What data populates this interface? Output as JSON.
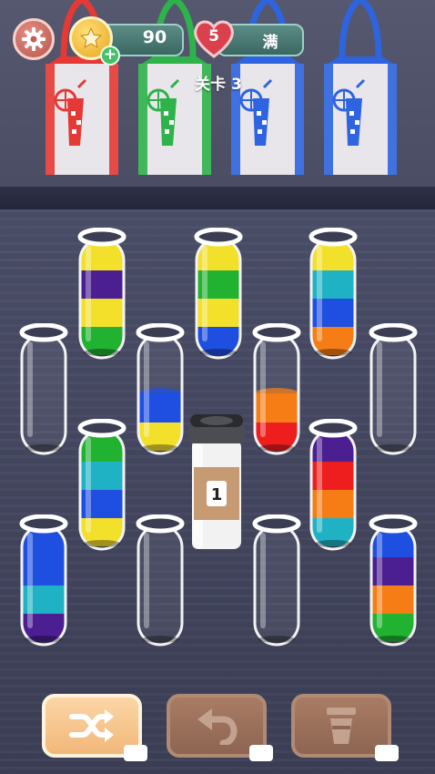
{
  "header": {
    "coins": "90",
    "lives": "5",
    "lives_status": "满",
    "level_label": "关卡 3"
  },
  "icons": {
    "settings": "gear-icon",
    "coin": "star-coin-icon",
    "add": "plus-icon",
    "life": "heart-icon",
    "shuffle": "shuffle-icon",
    "undo": "undo-icon",
    "add_tube": "cup-icon",
    "video": "video-ad-icon"
  },
  "bags": [
    {
      "color": "#e53935"
    },
    {
      "color": "#2eb24a"
    },
    {
      "color": "#2e64e0"
    },
    {
      "color": "#2e64e0"
    }
  ],
  "colors": {
    "green": "#22b232",
    "yellow": "#f3e02b",
    "purple": "#4b1e92",
    "blue": "#1f4fe0",
    "orange": "#f67d16",
    "cyan": "#1fb2c5",
    "red": "#ef1e1e",
    "empty": "transparent"
  },
  "tubes": [
    {
      "id": "tube-1",
      "layers": [
        "green",
        "yellow",
        "purple",
        "yellow"
      ]
    },
    {
      "id": "tube-2",
      "layers": [
        "blue",
        "yellow",
        "green",
        "yellow"
      ]
    },
    {
      "id": "tube-3",
      "layers": [
        "orange",
        "blue",
        "cyan",
        "yellow"
      ]
    },
    {
      "id": "tube-4",
      "layers": []
    },
    {
      "id": "tube-5",
      "layers": [
        "yellow",
        "blue"
      ]
    },
    {
      "id": "tube-6",
      "layers": [
        "red",
        "orange"
      ]
    },
    {
      "id": "tube-7",
      "layers": []
    },
    {
      "id": "tube-8",
      "layers": [
        "yellow",
        "blue",
        "cyan",
        "green"
      ]
    },
    {
      "id": "tube-9",
      "layers": [
        "cyan",
        "orange",
        "red",
        "purple"
      ]
    },
    {
      "id": "tube-10",
      "layers": [
        "purple",
        "cyan",
        "blue",
        "blue"
      ]
    },
    {
      "id": "tube-11",
      "layers": []
    },
    {
      "id": "tube-12",
      "layers": []
    },
    {
      "id": "tube-13",
      "layers": [
        "green",
        "orange",
        "purple",
        "blue"
      ]
    }
  ],
  "cup": {
    "label": "1"
  },
  "buttons": {
    "shuffle": {
      "enabled": true
    },
    "undo": {
      "enabled": false
    },
    "add_tube": {
      "enabled": false
    }
  }
}
